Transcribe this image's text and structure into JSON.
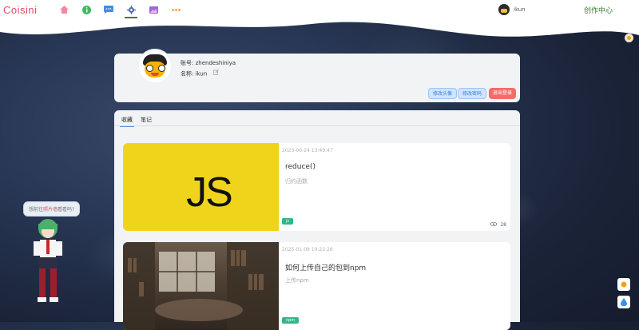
{
  "header": {
    "brand": "Coisini",
    "nav": [
      "home-icon",
      "info-icon",
      "chat-icon",
      "gear-icon",
      "image-icon",
      "more-icon"
    ],
    "user_name": "ikun",
    "creator_label": "创作中心"
  },
  "profile": {
    "account_label": "账号:",
    "account_value": "zhendeshiniya",
    "nickname_label": "名称:",
    "nickname_value": "ikun",
    "buttons": {
      "change_avatar": "修改头像",
      "change_password": "修改密码",
      "logout": "退出登录"
    }
  },
  "tabs": [
    "收藏",
    "笔记"
  ],
  "posts": [
    {
      "date": "2023-06-24 13:49:47",
      "title": "reduce()",
      "desc": "归约函数",
      "tag": "js",
      "views": "28",
      "thumb_text": "JS"
    },
    {
      "date": "2025-01-09 10:22:26",
      "title": "如何上传自己的包到npm",
      "desc": "上传npm",
      "tag": "npm"
    }
  ],
  "bubble": {
    "prefix": "想前往",
    "highlight": "照片墙",
    "suffix": "看看吗?"
  },
  "colors": {
    "brand": "#e84b67",
    "creator": "#2e7d32",
    "tag": "#2eb88a",
    "logout": "#f36c6c"
  }
}
